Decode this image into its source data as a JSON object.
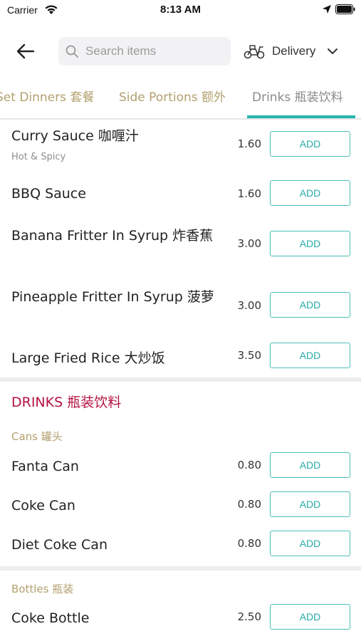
{
  "status_bar": {
    "carrier": "Carrier",
    "time": "8:13 AM"
  },
  "header": {
    "search_placeholder": "Search items",
    "delivery_label": "Delivery"
  },
  "tabs": [
    {
      "label": "Set Dinners 套餐"
    },
    {
      "label": "Side Portions 额外"
    },
    {
      "label": "Drinks 瓶装饮料"
    }
  ],
  "add_label": "ADD",
  "items_top": [
    {
      "name": "Curry Sauce 咖喱汁",
      "subtitle": "Hot & Spicy",
      "price": "1.60"
    },
    {
      "name": "BBQ Sauce",
      "price": "1.60"
    },
    {
      "name": "Banana Fritter In Syrup 炸香蕉",
      "price": "3.00"
    },
    {
      "name": "Pineapple Fritter In Syrup 菠萝",
      "price": "3.00"
    },
    {
      "name": "Large Fried Rice 大炒饭",
      "price": "3.50"
    }
  ],
  "drinks_section": {
    "title": "DRINKS 瓶装饮料",
    "cans_title": "Cans 罐头",
    "cans": [
      {
        "name": "Fanta Can",
        "price": "0.80"
      },
      {
        "name": "Coke Can",
        "price": "0.80"
      },
      {
        "name": "Diet Coke Can",
        "price": "0.80"
      }
    ],
    "bottles_title": "Bottles 瓶装",
    "bottles": [
      {
        "name": "Coke Bottle",
        "price": "2.50"
      }
    ]
  }
}
